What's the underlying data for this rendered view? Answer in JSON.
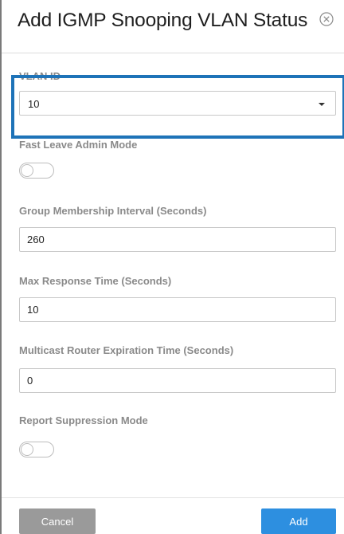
{
  "dialog": {
    "title": "Add IGMP Snooping VLAN Status",
    "close_icon": "close-circle-icon"
  },
  "fields": {
    "vlan_id": {
      "label": "VLAN ID",
      "value": "10"
    },
    "fast_leave": {
      "label": "Fast Leave Admin Mode",
      "state": "off"
    },
    "group_membership_interval": {
      "label": "Group Membership Interval (Seconds)",
      "value": "260"
    },
    "max_response_time": {
      "label": "Max Response Time (Seconds)",
      "value": "10"
    },
    "mcast_router_expiration": {
      "label": "Multicast Router Expiration Time (Seconds)",
      "value": "0"
    },
    "report_suppression": {
      "label": "Report Suppression Mode",
      "state": "off"
    }
  },
  "footer": {
    "cancel_label": "Cancel",
    "add_label": "Add"
  },
  "colors": {
    "highlight": "#1e73b8",
    "add_button": "#2d8fe0",
    "cancel_button": "#9a9a9a"
  }
}
